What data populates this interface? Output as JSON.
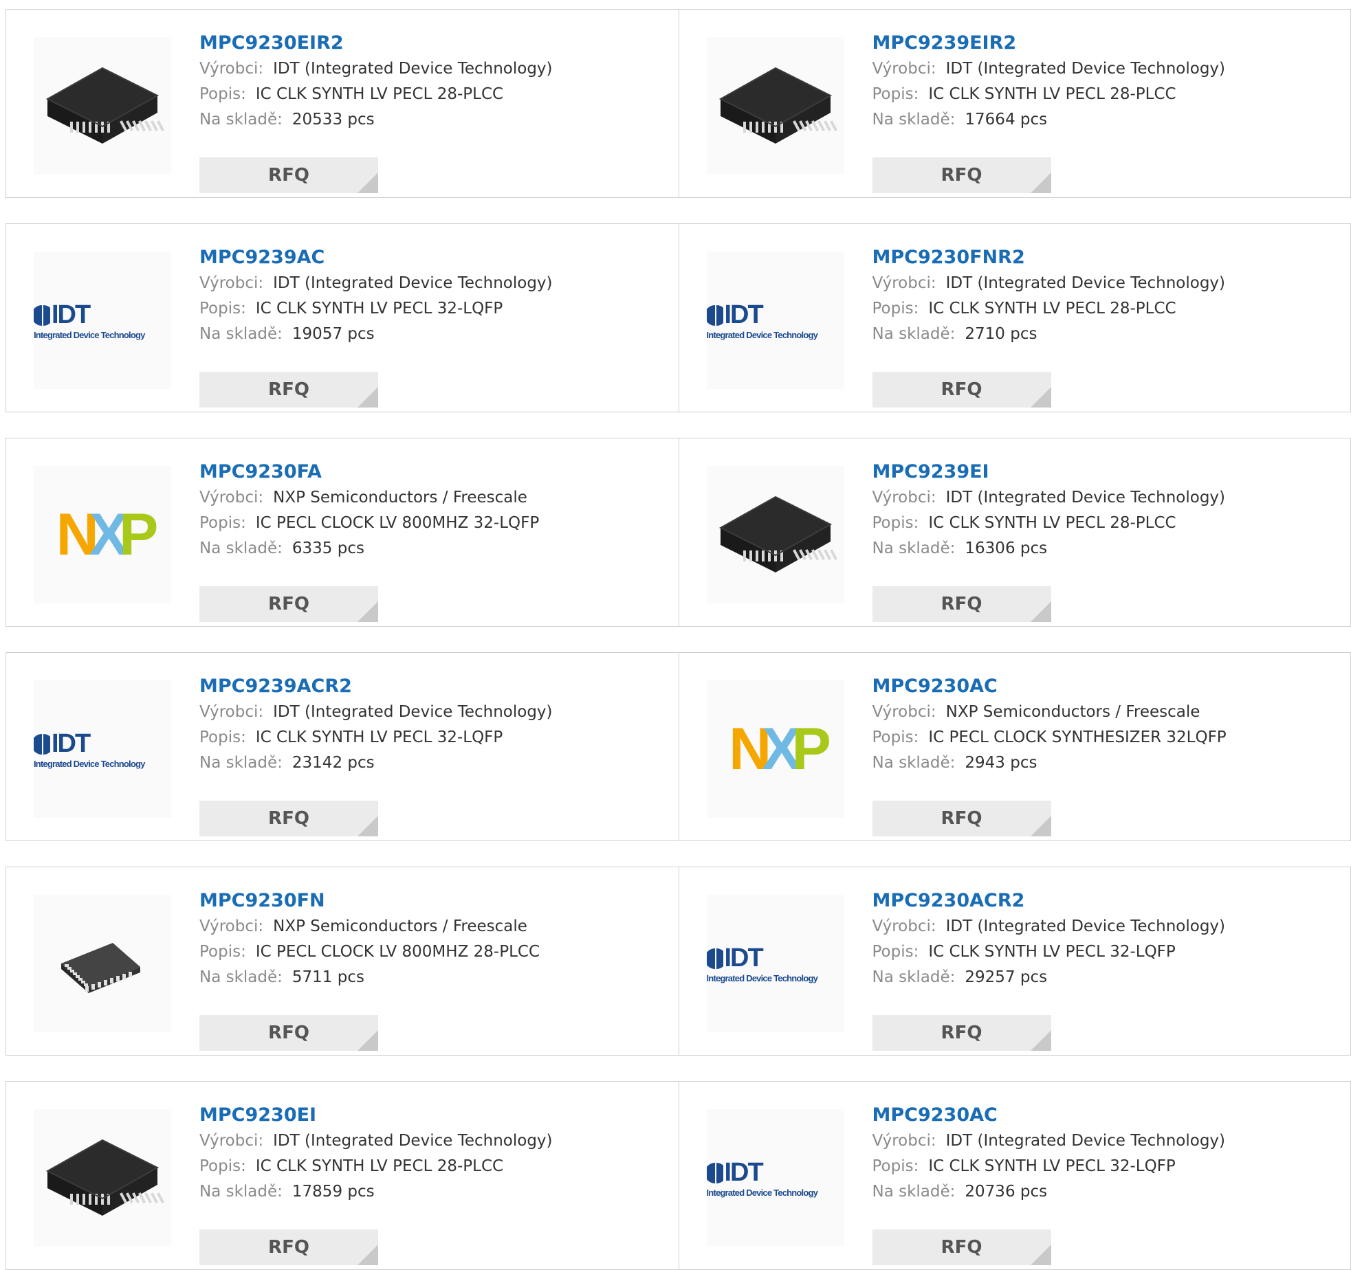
{
  "labels": {
    "manufacturer": "Výrobci:",
    "description": "Popis:",
    "stock": "Na skladě:",
    "rfq": "RFQ"
  },
  "logo_text": {
    "idt": "IDT",
    "idt_sub": "Integrated Device Technology",
    "nxp": [
      "N",
      "X",
      "P"
    ]
  },
  "colors": {
    "link": "#1a6db5",
    "nxp_orange": "#f5a700",
    "nxp_blue": "#6fb9e4",
    "nxp_green": "#a8c81a",
    "idt_blue": "#1b4a8f"
  },
  "products": [
    {
      "part": "MPC9230EIR2",
      "manufacturer": "IDT (Integrated Device Technology)",
      "description": "IC CLK SYNTH LV PECL 28-PLCC",
      "stock": "20533 pcs",
      "image": "plcc-chip-icon"
    },
    {
      "part": "MPC9239EIR2",
      "manufacturer": "IDT (Integrated Device Technology)",
      "description": "IC CLK SYNTH LV PECL 28-PLCC",
      "stock": "17664 pcs",
      "image": "plcc-chip-icon"
    },
    {
      "part": "MPC9239AC",
      "manufacturer": "IDT (Integrated Device Technology)",
      "description": "IC CLK SYNTH LV PECL 32-LQFP",
      "stock": "19057 pcs",
      "image": "idt-logo"
    },
    {
      "part": "MPC9230FNR2",
      "manufacturer": "IDT (Integrated Device Technology)",
      "description": "IC CLK SYNTH LV PECL 28-PLCC",
      "stock": "2710 pcs",
      "image": "idt-logo"
    },
    {
      "part": "MPC9230FA",
      "manufacturer": "NXP Semiconductors / Freescale",
      "description": "IC PECL CLOCK LV 800MHZ 32-LQFP",
      "stock": "6335 pcs",
      "image": "nxp-logo"
    },
    {
      "part": "MPC9239EI",
      "manufacturer": "IDT (Integrated Device Technology)",
      "description": "IC CLK SYNTH LV PECL 28-PLCC",
      "stock": "16306 pcs",
      "image": "plcc-chip-icon"
    },
    {
      "part": "MPC9239ACR2",
      "manufacturer": "IDT (Integrated Device Technology)",
      "description": "IC CLK SYNTH LV PECL 32-LQFP",
      "stock": "23142 pcs",
      "image": "idt-logo"
    },
    {
      "part": "MPC9230AC",
      "manufacturer": "NXP Semiconductors / Freescale",
      "description": "IC PECL CLOCK SYNTHESIZER 32LQFP",
      "stock": "2943 pcs",
      "image": "nxp-logo"
    },
    {
      "part": "MPC9230FN",
      "manufacturer": "NXP Semiconductors / Freescale",
      "description": "IC PECL CLOCK LV 800MHZ 28-PLCC",
      "stock": "5711 pcs",
      "image": "small-chip-icon"
    },
    {
      "part": "MPC9230ACR2",
      "manufacturer": "IDT (Integrated Device Technology)",
      "description": "IC CLK SYNTH LV PECL 32-LQFP",
      "stock": "29257 pcs",
      "image": "idt-logo"
    },
    {
      "part": "MPC9230EI",
      "manufacturer": "IDT (Integrated Device Technology)",
      "description": "IC CLK SYNTH LV PECL 28-PLCC",
      "stock": "17859 pcs",
      "image": "plcc-chip-icon"
    },
    {
      "part": "MPC9230AC",
      "manufacturer": "IDT (Integrated Device Technology)",
      "description": "IC CLK SYNTH LV PECL 32-LQFP",
      "stock": "20736 pcs",
      "image": "idt-logo"
    }
  ]
}
